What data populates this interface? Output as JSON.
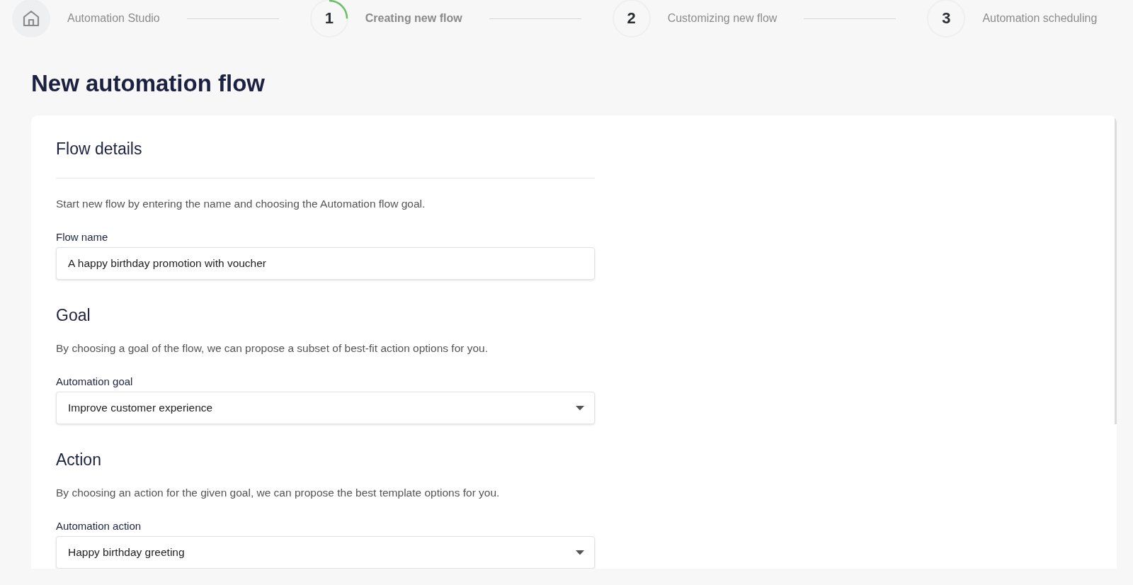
{
  "stepper": {
    "home_label": "Automation Studio",
    "steps": [
      {
        "number": "1",
        "label": "Creating new flow",
        "selected": true,
        "level": 0.25
      },
      {
        "number": "2",
        "label": "Customizing new flow",
        "selected": false
      },
      {
        "number": "3",
        "label": "Automation scheduling",
        "selected": false
      }
    ]
  },
  "page_title": "New automation flow",
  "card": {
    "title": "Flow details",
    "intro": "Start new flow by entering the name and choosing the Automation flow goal.",
    "field": {
      "kind": "text",
      "label": "Flow name",
      "value": "A happy birthday promotion with voucher"
    },
    "sections": [
      {
        "title": "Goal",
        "description": "By choosing a goal of the flow, we can propose a subset of best-fit action options for you.",
        "field": {
          "kind": "select",
          "label": "Automation goal",
          "value": "Improve customer experience"
        }
      },
      {
        "title": "Action",
        "description": "By choosing an action for the given goal, we can propose the best template options for you.",
        "field": {
          "kind": "select",
          "label": "Automation action",
          "value": "Happy birthday greeting"
        }
      }
    ]
  }
}
